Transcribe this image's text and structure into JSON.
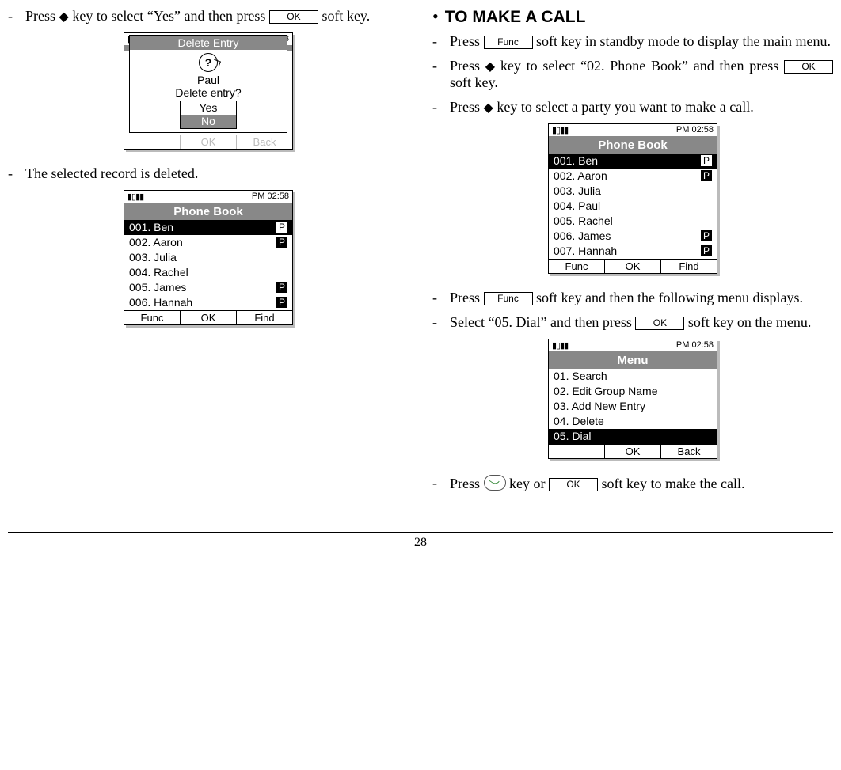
{
  "page_number": "28",
  "labels": {
    "ok": "OK",
    "func": "Func",
    "find": "Find",
    "back": "Back"
  },
  "left": {
    "step1_a": "Press ",
    "step1_b": " key to select “Yes” and then press ",
    "step1_c": " soft key.",
    "step2": "The selected record is deleted."
  },
  "right": {
    "heading": "TO MAKE A CALL",
    "step1_a": "Press ",
    "step1_b": " soft key in standby mode to display the main menu.",
    "step2_a": "Press ",
    "step2_b": " key to select “02. Phone Book” and then press ",
    "step2_c": " soft key.",
    "step3_a": "Press ",
    "step3_b": " key to select a party you want to make a call.",
    "step4_a": "Press ",
    "step4_b": " soft key and then the following menu displays.",
    "step5_a": "Select “05. Dial” and then press ",
    "step5_b": " soft key on the menu.",
    "step6_a": "Press ",
    "step6_b": " key or ",
    "step6_c": " soft key to make the call."
  },
  "screens": {
    "time": "PM 02:58",
    "phonebook_title": "Phone Book",
    "menu_title": "Menu",
    "delete_dialog": {
      "title": "Delete Entry",
      "name": "Paul",
      "prompt": "Delete entry?",
      "yes": "Yes",
      "no": "No",
      "ghost_ok": "OK",
      "ghost_back": "Back"
    },
    "list_after_delete": [
      {
        "label": "001. Ben",
        "tag": "P",
        "sel": true
      },
      {
        "label": "002. Aaron",
        "tag": "P"
      },
      {
        "label": "003. Julia"
      },
      {
        "label": "004. Rachel"
      },
      {
        "label": "005. James",
        "tag": "P"
      },
      {
        "label": "006. Hannah",
        "tag": "P"
      }
    ],
    "list_full": [
      {
        "label": "001. Ben",
        "tag": "P",
        "sel": true
      },
      {
        "label": "002. Aaron",
        "tag": "P"
      },
      {
        "label": "003. Julia"
      },
      {
        "label": "004. Paul"
      },
      {
        "label": "005. Rachel"
      },
      {
        "label": "006. James",
        "tag": "P"
      },
      {
        "label": "007. Hannah",
        "tag": "P"
      }
    ],
    "menu_list": [
      {
        "label": "01. Search"
      },
      {
        "label": "02. Edit Group Name"
      },
      {
        "label": "03. Add New Entry"
      },
      {
        "label": "04. Delete"
      },
      {
        "label": "05. Dial",
        "sel": true
      }
    ]
  }
}
